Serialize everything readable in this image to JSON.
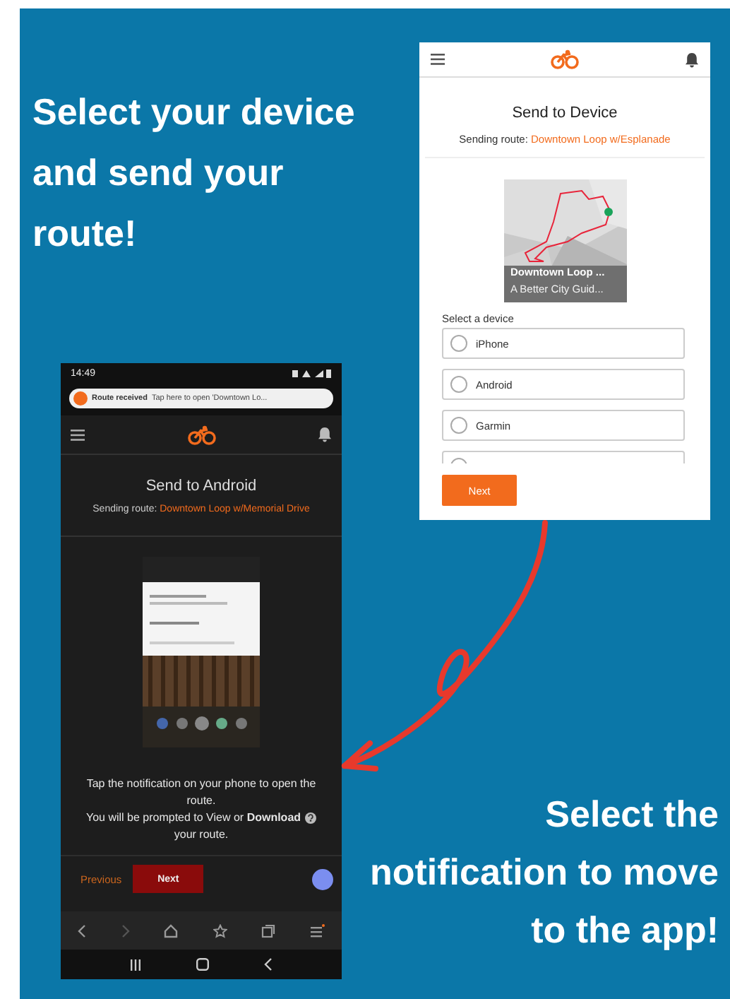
{
  "headline_top": "Select your device and send your route!",
  "headline_bottom": "Select the notification to move to the app!",
  "web_screen": {
    "title": "Send to Device",
    "route_label": "Sending route:",
    "route_name": "Downtown Loop w/Esplanade",
    "route_card": {
      "kind": "picture",
      "title": "Downtown Loop ...",
      "subtitle": "A Better City Guid..."
    },
    "device_label": "Select a device",
    "devices": [
      {
        "label": "iPhone",
        "selected": false
      },
      {
        "label": "Android",
        "selected": false
      },
      {
        "label": "Garmin",
        "selected": false
      },
      {
        "selected": false
      }
    ],
    "next_button": "Next"
  },
  "phone": {
    "status_time": "14:49",
    "notification": {
      "title": "Route received",
      "text": "Tap here to open 'Downtown Lo..."
    },
    "title": "Send to Android",
    "route_label": "Sending route:",
    "route_name": "Downtown Loop w/Memorial Drive",
    "instruction": "Tap the notification on your phone to open the route.",
    "prompt_before": "You will be prompted to View or **Download**",
    "prompt_after": "your route.",
    "previous_button": "Previous",
    "next_button": "Next"
  }
}
